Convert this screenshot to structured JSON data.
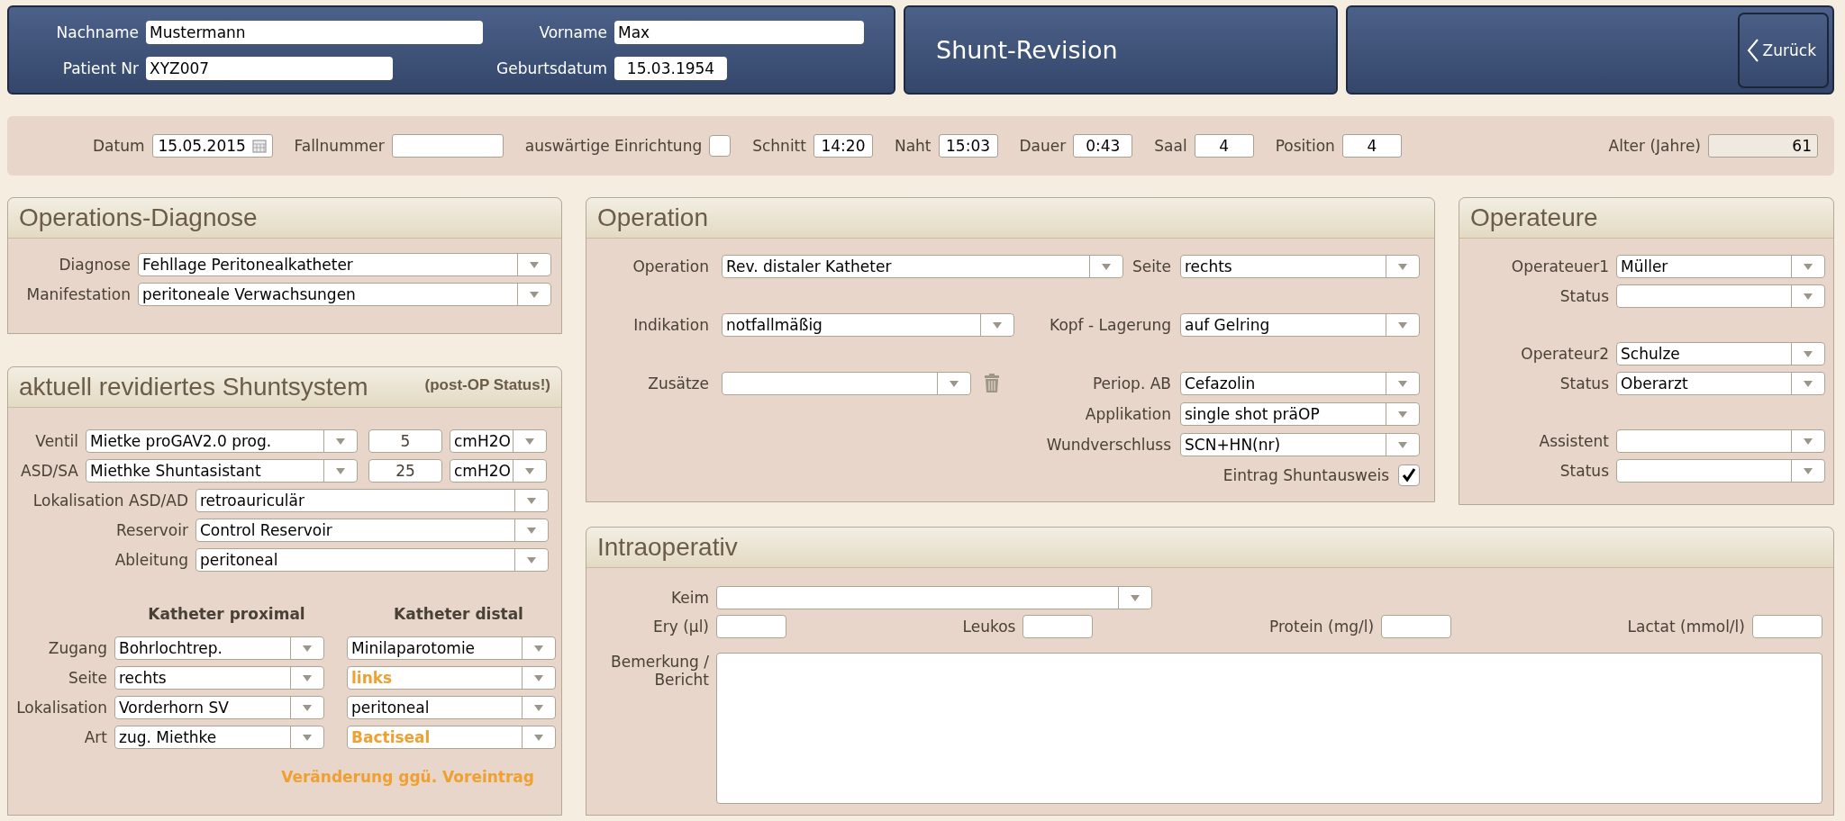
{
  "header": {
    "patient_fields": [
      {
        "label": "Nachname",
        "value": "Mustermann"
      },
      {
        "label": "Vorname",
        "value": "Max"
      },
      {
        "label": "Patient Nr",
        "value": "XYZ007"
      },
      {
        "label": "Geburtsdatum",
        "value": "15.03.1954"
      }
    ],
    "title": "Shunt-Revision",
    "back_button": "Zurück"
  },
  "case_bar": [
    {
      "kind": "date",
      "label": "Datum",
      "value": "15.05.2015"
    },
    {
      "kind": "text",
      "label": "Fallnummer"
    },
    {
      "kind": "checkbox",
      "label": "auswärtige Einrichtung",
      "checked": false
    },
    {
      "kind": "short",
      "label": "Schnitt",
      "value": "14:20"
    },
    {
      "kind": "short",
      "label": "Naht",
      "value": "15:03"
    },
    {
      "kind": "short",
      "label": "Dauer",
      "value": "0:43"
    },
    {
      "kind": "short",
      "label": "Saal",
      "value": "4"
    },
    {
      "kind": "short",
      "label": "Position",
      "value": "4"
    },
    {
      "kind": "readonly",
      "label": "Alter (Jahre)",
      "value": "61"
    }
  ],
  "diagnosis": {
    "title": "Operations-Diagnose",
    "rows": [
      {
        "label": "Diagnose",
        "value": "Fehllage Peritonealkatheter"
      },
      {
        "label": "Manifestation",
        "value": "peritoneale Verwachsungen"
      }
    ]
  },
  "shunt_system": {
    "title": "aktuell revidiertes Shuntsystem",
    "note": "(post-OP Status!)",
    "valve_rows": [
      {
        "label": "Ventil",
        "value": "Mietke proGAV2.0 prog.",
        "number": "5",
        "unit": "cmH2O"
      },
      {
        "label": "ASD/SA",
        "value": "Miethke Shuntasistant",
        "number": "25",
        "unit": "cmH2O"
      }
    ],
    "rows": [
      {
        "label": "Lokalisation ASD/AD",
        "value": "retroauriculär"
      },
      {
        "label": "Reservoir",
        "value": "Control Reservoir"
      },
      {
        "label": "Ableitung",
        "value": "peritoneal"
      }
    ],
    "catheter": {
      "headers": [
        "Katheter proximal",
        "Katheter distal"
      ],
      "rows": [
        {
          "label": "Zugang",
          "proximal": {
            "value": "Bohrlochtrep.",
            "changed": false
          },
          "distal": {
            "value": "Minilaparotomie",
            "changed": false
          }
        },
        {
          "label": "Seite",
          "proximal": {
            "value": "rechts",
            "changed": false
          },
          "distal": {
            "value": "links",
            "changed": true
          }
        },
        {
          "label": "Lokalisation",
          "proximal": {
            "value": "Vorderhorn SV",
            "changed": false
          },
          "distal": {
            "value": "peritoneal",
            "changed": false
          }
        },
        {
          "label": "Art",
          "proximal": {
            "value": "zug. Miethke",
            "changed": false
          },
          "distal": {
            "value": "Bactiseal",
            "changed": true
          }
        }
      ]
    },
    "legend": "Veränderung ggü. Voreintrag"
  },
  "operation": {
    "title": "Operation",
    "left": [
      {
        "label": "Operation",
        "value": "Rev. distaler Katheter"
      },
      {
        "label": "Indikation",
        "value": "notfallmäßig"
      },
      {
        "label": "Zusätze",
        "deletable": true
      }
    ],
    "right": [
      {
        "kind": "select",
        "label": "Seite",
        "value": "rechts"
      },
      {
        "kind": "select",
        "label": "Kopf - Lagerung",
        "value": "auf Gelring"
      },
      {
        "kind": "select",
        "label": "Periop. AB",
        "value": "Cefazolin"
      },
      {
        "kind": "select",
        "label": "Applikation",
        "value": "single shot präOP"
      },
      {
        "kind": "select",
        "label": "Wundverschluss",
        "value": "SCN+HN(nr)"
      },
      {
        "kind": "checkbox",
        "label": "Eintrag Shuntausweis",
        "checked": true
      }
    ]
  },
  "surgeons": {
    "title": "Operateure",
    "groups": [
      {
        "fields": [
          {
            "label": "Operateuer1",
            "value": "Müller"
          },
          {
            "label": "Status"
          }
        ]
      },
      {
        "fields": [
          {
            "label": "Operateur2",
            "value": "Schulze"
          },
          {
            "label": "Status",
            "value": "Oberarzt"
          }
        ]
      },
      {
        "fields": [
          {
            "label": "Assistent"
          },
          {
            "label": "Status"
          }
        ]
      }
    ]
  },
  "intraoperative": {
    "title": "Intraoperativ",
    "germ": {
      "label": "Keim"
    },
    "lab_values": [
      {
        "label": "Ery (µl)"
      },
      {
        "label": "Leukos"
      },
      {
        "label": "Protein (mg/l)"
      },
      {
        "label": "Lactat (mmol/l)"
      }
    ],
    "remark": {
      "label": "Bemerkung / Bericht"
    }
  }
}
